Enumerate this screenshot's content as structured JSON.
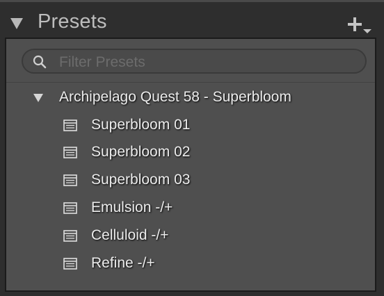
{
  "panel": {
    "title": "Presets",
    "add_icon": "plus-with-dropdown-icon",
    "collapse_icon": "triangle-down-icon"
  },
  "search": {
    "placeholder": "Filter Presets",
    "value": "",
    "icon": "search-icon"
  },
  "group": {
    "name": "Archipelago Quest 58 - Superbloom",
    "expanded": true,
    "icon": "triangle-down-icon"
  },
  "presets": [
    {
      "label": "Superbloom 01",
      "icon": "preset-list-icon"
    },
    {
      "label": "Superbloom 02",
      "icon": "preset-list-icon"
    },
    {
      "label": "Superbloom 03",
      "icon": "preset-list-icon"
    },
    {
      "label": "Emulsion -/+",
      "icon": "preset-list-icon"
    },
    {
      "label": "Celluloid -/+",
      "icon": "preset-list-icon"
    },
    {
      "label": "Refine -/+",
      "icon": "preset-list-icon"
    }
  ],
  "colors": {
    "panel_bg": "#4f4f4f",
    "header_bg": "#2e2e2e",
    "text": "#ececec",
    "header_text": "#bdbdbd"
  }
}
